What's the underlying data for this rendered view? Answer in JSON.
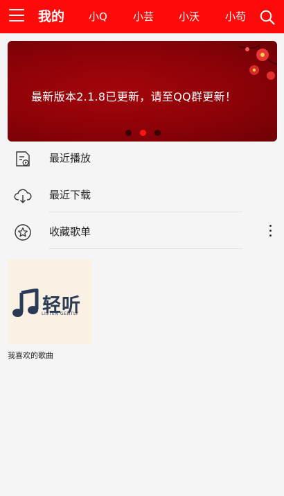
{
  "header": {
    "tabs": [
      {
        "label": "我的"
      },
      {
        "label": "小Q"
      },
      {
        "label": "小芸"
      },
      {
        "label": "小沃"
      },
      {
        "label": "小苟"
      }
    ],
    "accent_color": "#ff0a0a"
  },
  "banner": {
    "text": "最新版本2.1.8已更新，请至QQ群更新！",
    "active_slide": 2,
    "slide_count": 3
  },
  "list": {
    "items": [
      {
        "label": "最近播放",
        "icon": "recent-play-icon"
      },
      {
        "label": "最近下载",
        "icon": "cloud-download-icon"
      },
      {
        "label": "收藏歌单",
        "icon": "star-icon"
      }
    ]
  },
  "playlists": [
    {
      "name": "我喜欢的歌曲",
      "cover": {
        "title": "轻听",
        "subtitle": "LISTEN GENTLY"
      }
    }
  ]
}
